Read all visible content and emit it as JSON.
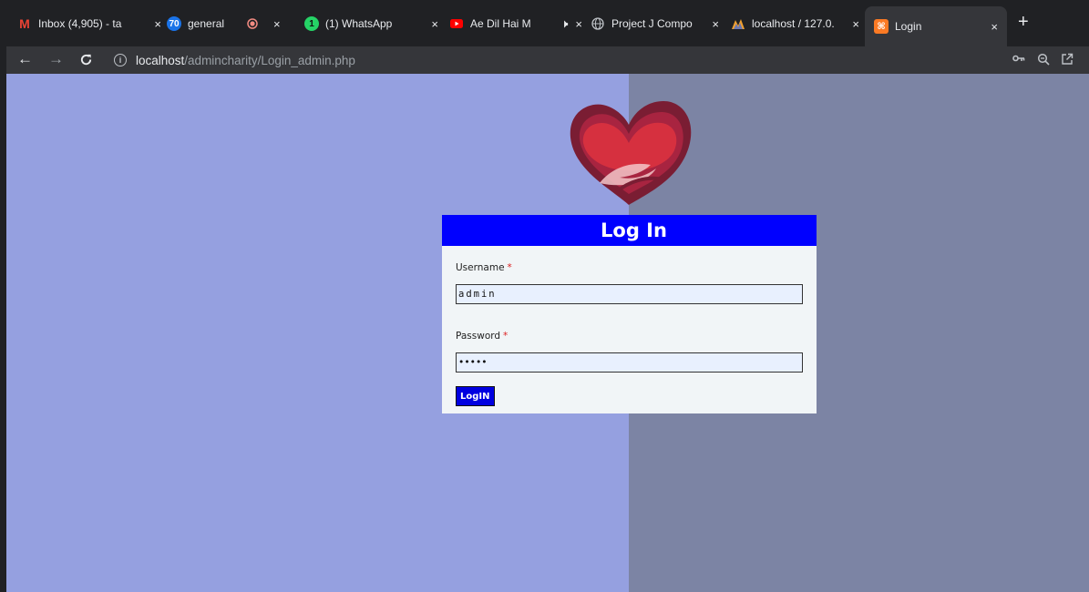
{
  "browser": {
    "tabs": [
      {
        "title": "Inbox (4,905) - ta",
        "icon": "gmail-icon",
        "close": "×"
      },
      {
        "title": "general",
        "icon": "app-icon",
        "badge": "70",
        "close": ""
      },
      {
        "title": "",
        "icon": "recording-icon",
        "close": "×"
      },
      {
        "title": "(1) WhatsApp",
        "icon": "whatsapp-icon",
        "badge": "1",
        "close": "×"
      },
      {
        "title": "Ae Dil Hai M",
        "icon": "youtube-icon",
        "close": "×"
      },
      {
        "title": "Project J Compo",
        "icon": "globe-icon",
        "close": "×"
      },
      {
        "title": "localhost / 127.0.",
        "icon": "phpmyadmin-icon",
        "close": "×"
      },
      {
        "title": "Login",
        "icon": "xampp-icon",
        "close": "×"
      }
    ],
    "new_tab": "+",
    "address": {
      "host": "localhost",
      "path": "/admincharity/Login_admin.php"
    },
    "toolbar_icons": [
      "key-icon",
      "zoom-icon",
      "share-icon"
    ]
  },
  "login": {
    "title": "Log In",
    "username_label": "Username",
    "username_value": "admin",
    "password_label": "Password",
    "password_value": "•••••",
    "required_mark": "*",
    "submit_label": "LogIN"
  },
  "colors": {
    "left_bg": "#95a0e0",
    "right_bg": "#7c84a4",
    "header_blue": "#0000ff",
    "button_blue": "#0000e0",
    "heart_red": "#d6303f",
    "heart_dark": "#7a1d33"
  }
}
